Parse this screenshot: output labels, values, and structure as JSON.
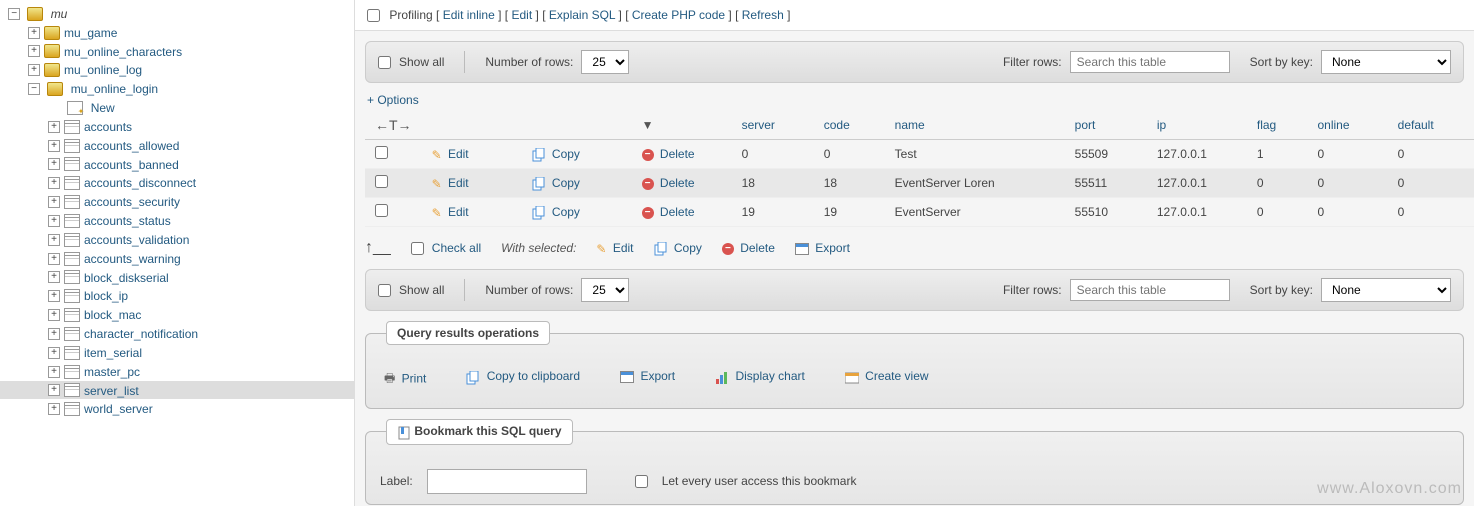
{
  "sidebar": {
    "root": "mu",
    "dbs": [
      "mu_game",
      "mu_online_characters",
      "mu_online_log"
    ],
    "expanded_db": "mu_online_login",
    "new_label": "New",
    "tables": [
      "accounts",
      "accounts_allowed",
      "accounts_banned",
      "accounts_disconnect",
      "accounts_security",
      "accounts_status",
      "accounts_validation",
      "accounts_warning",
      "block_diskserial",
      "block_ip",
      "block_mac",
      "character_notification",
      "item_serial",
      "master_pc",
      "server_list",
      "world_server"
    ],
    "selected_table": "server_list"
  },
  "profiling": {
    "label": "Profiling",
    "links": [
      "Edit inline",
      "Edit",
      "Explain SQL",
      "Create PHP code",
      "Refresh"
    ]
  },
  "controls": {
    "show_all": "Show all",
    "num_rows_label": "Number of rows:",
    "num_rows_value": "25",
    "filter_label": "Filter rows:",
    "filter_placeholder": "Search this table",
    "sort_label": "Sort by key:",
    "sort_value": "None"
  },
  "options_link": "+ Options",
  "table": {
    "columns": [
      "server",
      "code",
      "name",
      "port",
      "ip",
      "flag",
      "online",
      "default"
    ],
    "actions": {
      "edit": "Edit",
      "copy": "Copy",
      "delete": "Delete"
    },
    "rows": [
      {
        "server": "0",
        "code": "0",
        "name": "Test",
        "port": "55509",
        "ip": "127.0.0.1",
        "flag": "1",
        "online": "0",
        "default": "0"
      },
      {
        "server": "18",
        "code": "18",
        "name": "EventServer Loren",
        "port": "55511",
        "ip": "127.0.0.1",
        "flag": "0",
        "online": "0",
        "default": "0"
      },
      {
        "server": "19",
        "code": "19",
        "name": "EventServer",
        "port": "55510",
        "ip": "127.0.0.1",
        "flag": "0",
        "online": "0",
        "default": "0"
      }
    ]
  },
  "bulk": {
    "check_all": "Check all",
    "with_selected": "With selected:",
    "edit": "Edit",
    "copy": "Copy",
    "delete": "Delete",
    "export": "Export"
  },
  "ops": {
    "legend": "Query results operations",
    "print": "Print",
    "copy_clip": "Copy to clipboard",
    "export": "Export",
    "chart": "Display chart",
    "view": "Create view"
  },
  "bookmark": {
    "legend": "Bookmark this SQL query",
    "label": "Label:",
    "public": "Let every user access this bookmark"
  },
  "watermark": "www.Aloxovn.com"
}
